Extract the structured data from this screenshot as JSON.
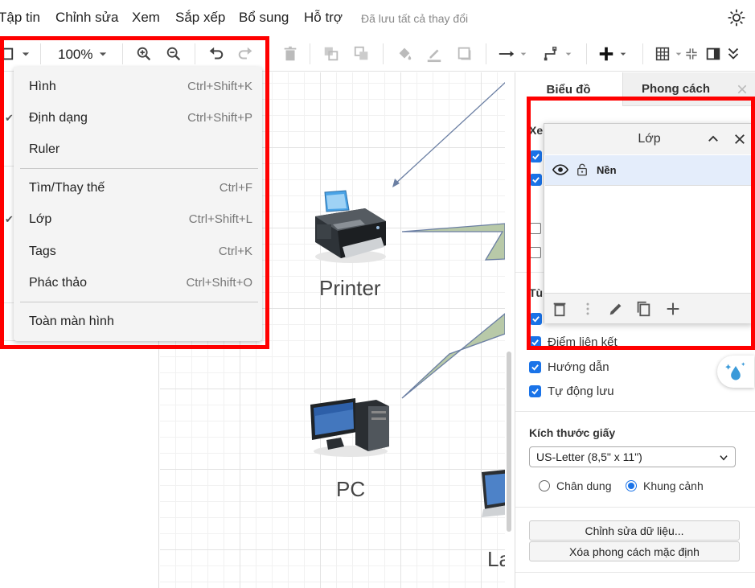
{
  "menubar": {
    "items": [
      "Tập tin",
      "Chỉnh sửa",
      "Xem",
      "Sắp xếp",
      "Bổ sung",
      "Hỗ trợ"
    ],
    "save_status": "Đã lưu tất cả thay đổi"
  },
  "toolbar": {
    "zoom": "100%"
  },
  "view_menu": {
    "items": [
      {
        "label": "Hình",
        "shortcut": "Ctrl+Shift+K"
      },
      {
        "label": "Định dạng",
        "shortcut": "Ctrl+Shift+P"
      },
      {
        "label": "Ruler",
        "shortcut": ""
      },
      {
        "label": "Tìm/Thay thế",
        "shortcut": "Ctrl+F"
      },
      {
        "label": "Lớp",
        "shortcut": "Ctrl+Shift+L"
      },
      {
        "label": "Tags",
        "shortcut": "Ctrl+K"
      },
      {
        "label": "Phác thảo",
        "shortcut": "Ctrl+Shift+O"
      },
      {
        "label": "Toàn màn hình",
        "shortcut": ""
      }
    ]
  },
  "canvas": {
    "nodes": [
      {
        "label": "Printer"
      },
      {
        "label": "PC"
      },
      {
        "label": "La"
      }
    ]
  },
  "format_panel": {
    "tabs": [
      "Biểu đồ",
      "Phong cách"
    ],
    "partial_labels": {
      "view_header": "Xe",
      "options_header": "Tù",
      "connection_points": "Điểm liên kết"
    },
    "guides": "Hướng dẫn",
    "autosave": "Tự động lưu",
    "paper_size_label": "Kích thước giấy",
    "paper_size_value": "US-Letter (8,5\" x 11\")",
    "portrait": "Chân dung",
    "landscape": "Khung cảnh",
    "edit_data": "Chỉnh sửa dữ liệu...",
    "clear_default_style": "Xóa phong cách mặc định"
  },
  "layers_window": {
    "title": "Lớp",
    "layers": [
      {
        "name": "Nền"
      }
    ]
  },
  "colors": {
    "highlight": "#ff0000",
    "accent": "#1a73e8",
    "edge": "#6b7fa3",
    "shape_fill": "#b8c9a8"
  }
}
